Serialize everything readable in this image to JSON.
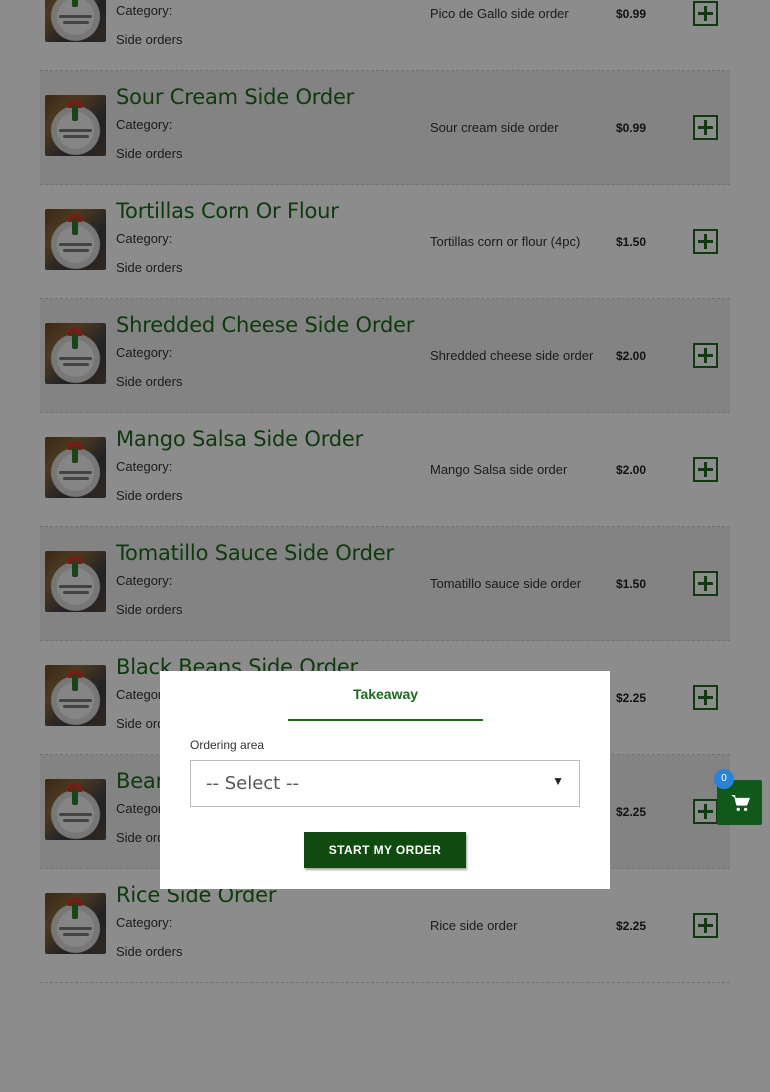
{
  "menu": {
    "category_label": "Category:",
    "items": [
      {
        "title": "",
        "category": "Side orders",
        "description": "Pico de Gallo side order",
        "price": "$0.99"
      },
      {
        "title": "Sour Cream Side Order",
        "category": "Side orders",
        "description": "Sour cream side order",
        "price": "$0.99"
      },
      {
        "title": "Tortillas Corn Or Flour",
        "category": "Side orders",
        "description": "Tortillas corn or flour  (4pc)",
        "price": "$1.50"
      },
      {
        "title": "Shredded Cheese Side Order",
        "category": "Side orders",
        "description": "Shredded cheese side order",
        "price": "$2.00"
      },
      {
        "title": "Mango Salsa Side Order",
        "category": "Side orders",
        "description": "Mango Salsa side order",
        "price": "$2.00"
      },
      {
        "title": "Tomatillo Sauce Side Order",
        "category": "Side orders",
        "description": "Tomatillo sauce side order",
        "price": "$1.50"
      },
      {
        "title": "Black Beans Side Order",
        "category": "Side orders",
        "description": "",
        "price": "$2.25"
      },
      {
        "title": "Bean",
        "category": "Side orders",
        "description": "",
        "price": "$2.25"
      },
      {
        "title": "Rice Side Order",
        "category": "Side orders",
        "description": "Rice side order",
        "price": "$2.25"
      }
    ]
  },
  "modal": {
    "tab_label": "Takeaway",
    "area_label": "Ordering area",
    "select_value": "-- Select --",
    "start_button_label": "START MY ORDER"
  },
  "cart": {
    "count": "0",
    "icon": "shopping-cart-icon"
  },
  "colors": {
    "accent": "#1b6b1b",
    "button_dark": "#0f4a0f",
    "badge": "#2a83d8"
  }
}
